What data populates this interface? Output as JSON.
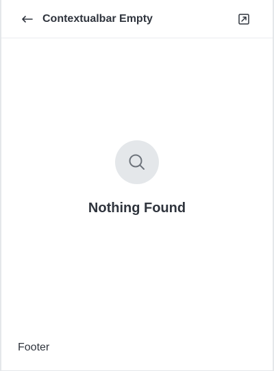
{
  "header": {
    "title": "Contextualbar Empty",
    "back_icon": "back-arrow-icon",
    "open_icon": "new-window-icon"
  },
  "empty_state": {
    "icon": "magnifier-icon",
    "title": "Nothing Found"
  },
  "footer": {
    "text": "Footer"
  },
  "colors": {
    "text": "#2f343d",
    "icon": "#6c727a",
    "icon_bg": "#e4e7ea",
    "border": "#ebecef"
  }
}
